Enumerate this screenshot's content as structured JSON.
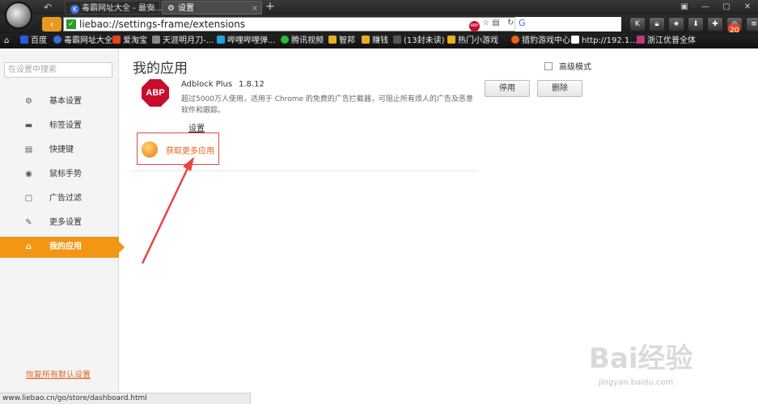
{
  "tabs": {
    "tab1_title": "毒霸网址大全 - 最安...",
    "tab2_title": "设置",
    "tab1_icon_letter": "K"
  },
  "address": {
    "url": "liebao://settings-frame/extensions",
    "abp_mini": "ABP",
    "search_icon_letter": "G"
  },
  "toolbar": {
    "badge_count": "20"
  },
  "bookmarks": [
    {
      "label": "百度",
      "color": "#2b5bd8"
    },
    {
      "label": "毒霸网址大全",
      "color": "#3a6fd8"
    },
    {
      "label": "爱淘宝",
      "color": "#e8451f"
    },
    {
      "label": "天涯明月刀-...",
      "color": "#888888"
    },
    {
      "label": "哔哩哔哩弹...",
      "color": "#23a3d8"
    },
    {
      "label": "腾讯视频",
      "color": "#2bbd3a"
    },
    {
      "label": "智邦",
      "color": "#e8b020"
    },
    {
      "label": "赚钱",
      "color": "#e8b020"
    },
    {
      "label": "(13封未读) ...",
      "color": "#1a1a1a"
    },
    {
      "label": "热门小游戏",
      "color": "#e8b020"
    },
    {
      "label": "猎豹游戏中心",
      "color": "#e8641f"
    },
    {
      "label": "http://192.1...",
      "color": "#ffffff"
    },
    {
      "label": "浙江优普全体",
      "color": "#c0397a"
    }
  ],
  "sidebar": {
    "search_placeholder": "在设置中搜索",
    "items": [
      {
        "label": "基本设置",
        "icon": "⚙"
      },
      {
        "label": "标签设置",
        "icon": "▬"
      },
      {
        "label": "快捷键",
        "icon": "▤"
      },
      {
        "label": "鼠标手势",
        "icon": "◉"
      },
      {
        "label": "广告过滤",
        "icon": "▢"
      },
      {
        "label": "更多设置",
        "icon": "✎"
      },
      {
        "label": "我的应用",
        "icon": "⌂"
      }
    ],
    "restore_label": "恢复所有默认设置"
  },
  "main": {
    "title": "我的应用",
    "advanced_mode_label": "高级模式",
    "extension": {
      "icon_text": "ABP",
      "name": "Adblock Plus",
      "version": "1.8.12",
      "description": "超过5000万人使用，适用于 Chrome 的免费的广告拦截器，可阻止所有烦人的广告及恶意软件和跟踪。",
      "settings_label": "设置",
      "disable_label": "停用",
      "delete_label": "删除"
    },
    "get_more_label": "获取更多应用"
  },
  "status_url": "www.liebao.cn/go/store/dashboard.html",
  "watermark": {
    "brand": "Bai经验",
    "url": "jingyan.baidu.com"
  },
  "colors": {
    "accent": "#f29613",
    "link": "#e8641f",
    "abp_red": "#c70d2c",
    "annotation_red": "#e84545"
  }
}
